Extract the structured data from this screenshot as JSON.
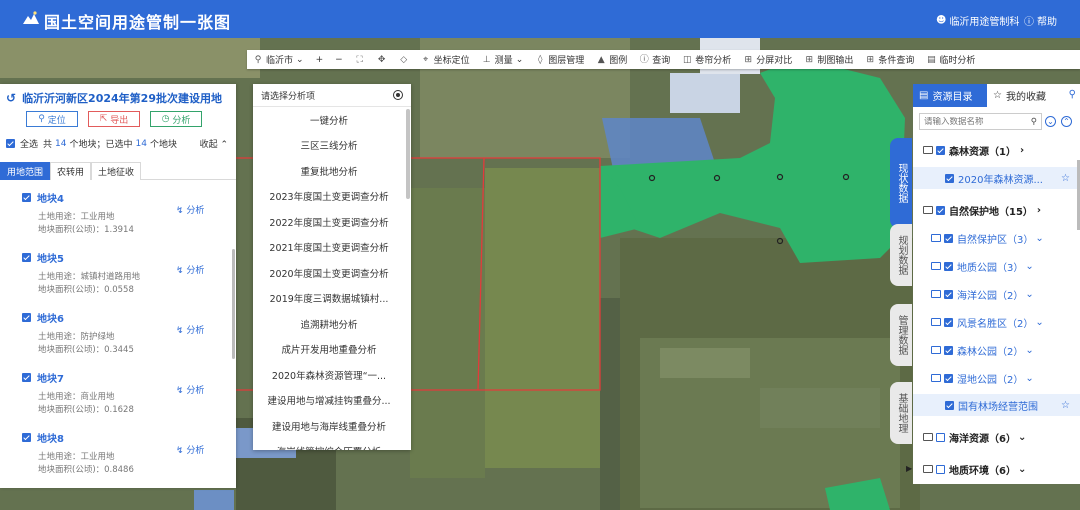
{
  "header": {
    "title": "国土空间用途管制一张图",
    "user": "临沂用途管制科",
    "help": "帮助"
  },
  "toolbar": {
    "items": [
      {
        "icon": "location-pin-icon",
        "label": "临沂市",
        "dropdown": true
      },
      {
        "icon": "zoom-in-icon",
        "label": "+"
      },
      {
        "icon": "zoom-out-icon",
        "label": "−"
      },
      {
        "icon": "fullscreen-icon",
        "label": ""
      },
      {
        "icon": "pan-icon",
        "label": ""
      },
      {
        "icon": "eraser-icon",
        "label": ""
      },
      {
        "icon": "coordinate-icon",
        "label": "坐标定位"
      },
      {
        "icon": "measure-icon",
        "label": "测量",
        "dropdown": true
      },
      {
        "icon": "layers-icon",
        "label": "图层管理"
      },
      {
        "icon": "legend-icon",
        "label": "图例"
      },
      {
        "icon": "info-icon",
        "label": "查询"
      },
      {
        "icon": "roll-compare-icon",
        "label": "卷帘分析"
      },
      {
        "icon": "split-screen-icon",
        "label": "分屏对比"
      },
      {
        "icon": "print-icon",
        "label": "制图输出"
      },
      {
        "icon": "condition-search-icon",
        "label": "条件查询"
      },
      {
        "icon": "temp-analysis-icon",
        "label": "临时分析"
      }
    ]
  },
  "left_panel": {
    "title": "临沂沂河新区2024年第29批次建设用地",
    "buttons": {
      "locate": "定位",
      "export": "导出",
      "analyze": "分析"
    },
    "select_all": "全选",
    "total_prefix": "共",
    "total_count": "14",
    "total_suffix": "个地块；已选中",
    "selected_count": "14",
    "selected_suffix": "个地块",
    "collapse": "收起",
    "tabs": [
      "用地范围",
      "农转用",
      "土地征收"
    ],
    "plots": [
      {
        "name": "地块4",
        "use": "土地用途：工业用地",
        "area": "地块面积(公顷)：1.3914"
      },
      {
        "name": "地块5",
        "use": "土地用途：城镇村道路用地",
        "area": "地块面积(公顷)：0.0558"
      },
      {
        "name": "地块6",
        "use": "土地用途：防护绿地",
        "area": "地块面积(公顷)：0.3445"
      },
      {
        "name": "地块7",
        "use": "土地用途：商业用地",
        "area": "地块面积(公顷)：0.1628"
      },
      {
        "name": "地块8",
        "use": "土地用途：工业用地",
        "area": "地块面积(公顷)：0.8486"
      }
    ],
    "analyze_label": "分析"
  },
  "analysis_dropdown": {
    "header": "请选择分析项",
    "items": [
      "一键分析",
      "三区三线分析",
      "重复批地分析",
      "2023年度国土变更调查分析",
      "2022年度国土变更调查分析",
      "2021年度国土变更调查分析",
      "2020年度国土变更调查分析",
      "2019年度三调数据城镇村...",
      "追溯耕地分析",
      "成片开发用地重叠分析",
      "2020年森林资源管理“一...",
      "建设用地与增减挂钩重叠分...",
      "建设用地与海岸线重叠分析",
      "海岸线管控综合压覆分析"
    ]
  },
  "right_panel": {
    "tabs": [
      "资源目录",
      "我的收藏"
    ],
    "search_placeholder": "请输入数据名称",
    "side_tabs": [
      "现状数据",
      "规划数据",
      "管理数据",
      "基础地理"
    ],
    "tree": [
      {
        "label": "森林资源（1）",
        "level": 1,
        "arrow": "›"
      },
      {
        "label": "2020年森林资源...",
        "level": 3
      },
      {
        "label": "自然保护地（15）",
        "level": 1,
        "arrow": "›"
      },
      {
        "label": "自然保护区（3）",
        "level": 2,
        "arrow": "⌄"
      },
      {
        "label": "地质公园（3）",
        "level": 2,
        "arrow": "⌄"
      },
      {
        "label": "海洋公园（2）",
        "level": 2,
        "arrow": "⌄"
      },
      {
        "label": "风景名胜区（2）",
        "level": 2,
        "arrow": "⌄"
      },
      {
        "label": "森林公园（2）",
        "level": 2,
        "arrow": "⌄"
      },
      {
        "label": "湿地公园（2）",
        "level": 2,
        "arrow": "⌄"
      },
      {
        "label": "国有林场经营范围",
        "level": 3
      },
      {
        "label": "海洋资源（6）",
        "level": 1,
        "arrow": "⌄"
      },
      {
        "label": "地质环境（6）",
        "level": 1,
        "arrow": "⌄"
      }
    ]
  },
  "colors": {
    "header": "#2f6bd6",
    "accent": "#2f6bd6",
    "highlight_green": "#2fb36a",
    "boundary_red": "#e23b3b"
  }
}
